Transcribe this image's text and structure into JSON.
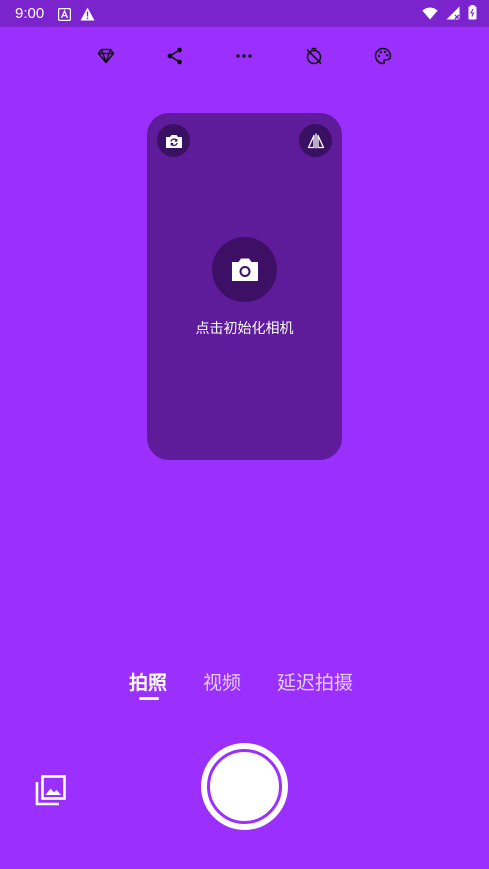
{
  "status_bar": {
    "time": "9:00",
    "icons": [
      "app-store-icon",
      "warning-icon",
      "wifi-icon",
      "signal-icon",
      "battery-icon"
    ]
  },
  "toolbar": {
    "icons": [
      "diamond-icon",
      "share-icon",
      "more-icon",
      "timer-off-icon",
      "palette-icon"
    ]
  },
  "preview": {
    "switch_camera_icon": "flip-camera-icon",
    "mirror_icon": "mirror-icon",
    "init_label": "点击初始化相机"
  },
  "modes": {
    "items": [
      "拍照",
      "视频",
      "延迟拍摄"
    ],
    "active": "拍照"
  },
  "bottom": {
    "gallery_icon": "gallery-icon",
    "shutter": "shutter-button"
  },
  "colors": {
    "background": "#9b2ffe",
    "status_bar": "#7b23cc",
    "preview_card": "#5e1b9a",
    "icon_circle": "#3a1063"
  }
}
